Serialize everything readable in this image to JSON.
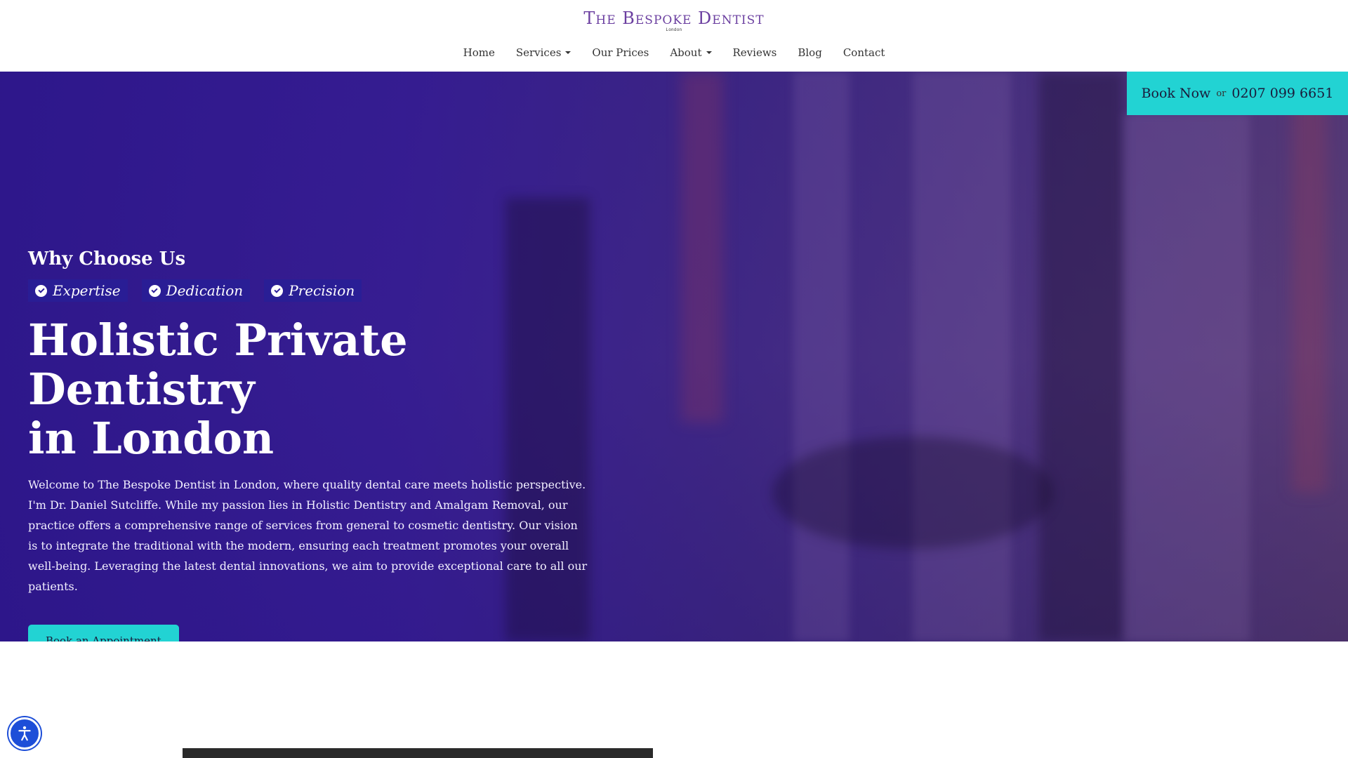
{
  "header": {
    "logo_title": "The Bespoke Dentist",
    "logo_sub": "London",
    "nav": [
      {
        "label": "Home"
      },
      {
        "label": "Services"
      },
      {
        "label": "Our Prices"
      },
      {
        "label": "About"
      },
      {
        "label": "Blog"
      },
      {
        "label": "Reviews"
      },
      {
        "label": "Contact"
      }
    ]
  },
  "book_bar": {
    "book_label": "Book Now",
    "or_label": "or",
    "phone": "0207 099 6651"
  },
  "hero": {
    "why_title": "Why Choose Us",
    "badges": [
      "Expertise",
      "Dedication",
      "Precision"
    ],
    "headline_line1": "Holistic Private Dentistry",
    "headline_line2": "in London",
    "intro": "Welcome to The Bespoke Dentist in London, where quality dental care meets holistic perspective. I'm Dr. Daniel Sutcliffe. While my passion lies in Holistic Dentistry and Amalgam Removal, our practice offers a comprehensive range of services from general to cosmetic dentistry. Our vision is to integrate the traditional with the modern, ensuring each treatment promotes your overall well-being. Leveraging the latest dental innovations, we aim to provide exceptional care to all our patients.",
    "cta_label": "Book an Appointment"
  },
  "colors": {
    "brand_purple": "#6b3fa0",
    "accent_teal": "#22d3d3",
    "hero_blue": "#2d168c"
  }
}
